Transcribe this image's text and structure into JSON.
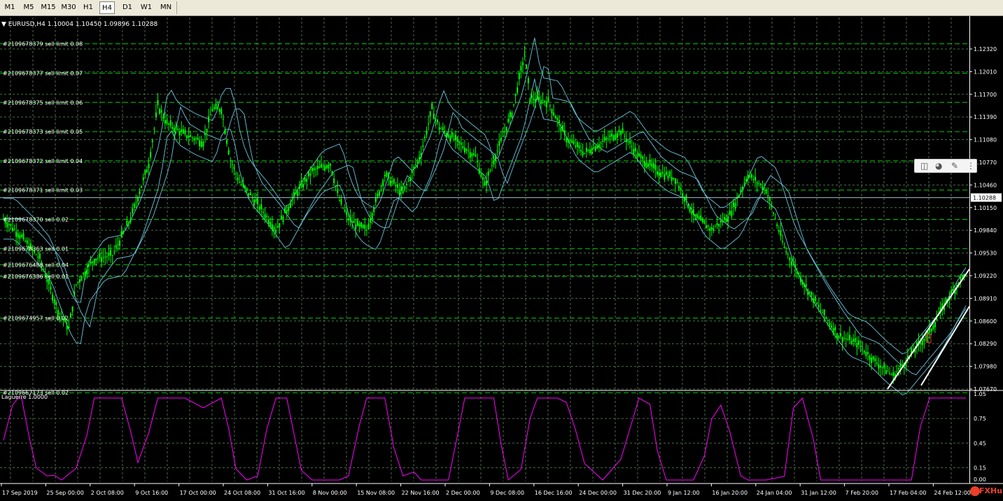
{
  "timeframes": [
    "M1",
    "M5",
    "M15",
    "M30",
    "H1",
    "H4",
    "D1",
    "W1",
    "MN"
  ],
  "active_timeframe": "H4",
  "header_line": "▼ EURUSD,H4  1.10004 1.10450 1.09896 1.10288",
  "indicator_label": "Laguerre 1.0000",
  "current_price": "1.10288",
  "watermark": "FXHub",
  "colors": {
    "candle": "#00ff00",
    "envelope": "#5fb3c9",
    "grid": "#4a6e4a",
    "laguerre": "#ff00ff",
    "level_line": "#00cc00",
    "axis_text": "#ffffff",
    "channel": "#ffffff"
  },
  "icons": [
    "split-view-icon",
    "sphere-icon",
    "pen-icon",
    "grip-icon"
  ],
  "orders": [
    {
      "label": "#2109678379 sell limit 0.08",
      "price": 1.1239
    },
    {
      "label": "#2109678377 sell limit 0.07",
      "price": 1.1199
    },
    {
      "label": "#2109678375 sell limit 0.06",
      "price": 1.1159
    },
    {
      "label": "#2109678373 sell limit 0.05",
      "price": 1.1119
    },
    {
      "label": "#2109678372 sell limit 0.04",
      "price": 1.1079
    },
    {
      "label": "#2109678371 sell limit 0.03",
      "price": 1.1039
    },
    {
      "label": "#2109678370 sell 0.02",
      "price": 1.0999
    },
    {
      "label": "#2109678363 sell 0.01",
      "price": 1.0959
    },
    {
      "label": "#2109676488 sell 0.04",
      "price": 1.0937
    },
    {
      "label": "#2109676386 sell 0.01",
      "price": 1.0921
    },
    {
      "label": "#2109674957 sell 0.02",
      "price": 1.0864
    },
    {
      "label": "#2109667173 sell 0.02",
      "price": 1.0762
    }
  ],
  "price_axis": [
    "1.12320",
    "1.12010",
    "1.11700",
    "1.11390",
    "1.11080",
    "1.10770",
    "1.10460",
    "1.10150",
    "1.09840",
    "1.09530",
    "1.09220",
    "1.08910",
    "1.08600",
    "1.08290",
    "1.07980",
    "1.07670"
  ],
  "indicator_axis": [
    "1.05",
    "0.75",
    "0.45",
    "0.15",
    "0.00"
  ],
  "time_axis": [
    "17 Sep 2019",
    "25 Sep 00:00",
    "2 Oct 08:00",
    "9 Oct 16:00",
    "17 Oct 00:00",
    "24 Oct 08:00",
    "31 Oct 16:00",
    "8 Nov 00:00",
    "15 Nov 08:00",
    "22 Nov 16:00",
    "2 Dec 00:00",
    "9 Dec 08:00",
    "16 Dec 16:00",
    "24 Dec 00:00",
    "31 Dec 20:00",
    "9 Jan 12:00",
    "16 Jan 20:00",
    "24 Jan 04:00",
    "31 Jan 12:00",
    "7 Feb 20:00",
    "17 Feb 04:00",
    "24 Feb 12:00"
  ],
  "chart_data": {
    "type": "candlestick",
    "symbol": "EURUSD",
    "timeframe": "H4",
    "ohlc_last": {
      "open": 1.10004,
      "high": 1.1045,
      "low": 1.09896,
      "close": 1.10288
    },
    "ylim": [
      1.0767,
      1.1275
    ],
    "x_labels": [
      "17 Sep 2019",
      "25 Sep 00:00",
      "2 Oct 08:00",
      "9 Oct 16:00",
      "17 Oct 00:00",
      "24 Oct 08:00",
      "31 Oct 16:00",
      "8 Nov 00:00",
      "15 Nov 08:00",
      "22 Nov 16:00",
      "2 Dec 00:00",
      "9 Dec 08:00",
      "16 Dec 16:00",
      "24 Dec 00:00",
      "31 Dec 20:00",
      "9 Jan 12:00",
      "16 Jan 20:00",
      "24 Jan 04:00",
      "31 Jan 12:00",
      "7 Feb 20:00",
      "17 Feb 04:00",
      "24 Feb 12:00"
    ],
    "close_path": [
      [
        0,
        1.1
      ],
      [
        1,
        1.0975
      ],
      [
        2,
        1.0945
      ],
      [
        3,
        1.0875
      ],
      [
        3.6,
        1.085
      ],
      [
        4,
        1.091
      ],
      [
        5,
        1.0945
      ],
      [
        6,
        1.095
      ],
      [
        7,
        1.1
      ],
      [
        8,
        1.1075
      ],
      [
        8.5,
        1.1155
      ],
      [
        9,
        1.113
      ],
      [
        10,
        1.1115
      ],
      [
        11,
        1.1105
      ],
      [
        11.5,
        1.115
      ],
      [
        12,
        1.115
      ],
      [
        12.5,
        1.108
      ],
      [
        13,
        1.105
      ],
      [
        14,
        1.102
      ],
      [
        15,
        1.0985
      ],
      [
        16,
        1.103
      ],
      [
        17,
        1.1065
      ],
      [
        18,
        1.1075
      ],
      [
        18.5,
        1.1025
      ],
      [
        19,
        1.1
      ],
      [
        19.5,
        1.099
      ],
      [
        20,
        1.0985
      ],
      [
        21,
        1.106
      ],
      [
        22,
        1.1035
      ],
      [
        23,
        1.109
      ],
      [
        23.6,
        1.115
      ],
      [
        24,
        1.1125
      ],
      [
        25,
        1.1105
      ],
      [
        26,
        1.1085
      ],
      [
        26.5,
        1.1045
      ],
      [
        27,
        1.108
      ],
      [
        28,
        1.1145
      ],
      [
        28.7,
        1.1225
      ],
      [
        29,
        1.1165
      ],
      [
        30,
        1.116
      ],
      [
        31,
        1.111
      ],
      [
        32,
        1.109
      ],
      [
        33,
        1.1105
      ],
      [
        34,
        1.112
      ],
      [
        35,
        1.1085
      ],
      [
        36,
        1.1065
      ],
      [
        37,
        1.1055
      ],
      [
        38,
        1.1005
      ],
      [
        39,
        1.0985
      ],
      [
        40,
        1.1005
      ],
      [
        41,
        1.106
      ],
      [
        42,
        1.104
      ],
      [
        43,
        1.096
      ],
      [
        44,
        1.0915
      ],
      [
        45,
        1.0875
      ],
      [
        46,
        1.084
      ],
      [
        47,
        1.083
      ],
      [
        48,
        1.0805
      ],
      [
        49,
        1.0785
      ],
      [
        50,
        1.0815
      ],
      [
        51,
        1.0845
      ],
      [
        52,
        1.089
      ],
      [
        53,
        1.0928
      ]
    ],
    "envelope_offset": 0.0028,
    "open_orders_prices": [
      1.1239,
      1.1199,
      1.1159,
      1.1119,
      1.1079,
      1.1039,
      1.0999,
      1.0959,
      1.0937,
      1.0921,
      1.0864,
      1.0762
    ],
    "current_price": 1.10288,
    "indicator": {
      "name": "Laguerre",
      "ylim": [
        0,
        1.05
      ],
      "levels": [
        0.75,
        0.45,
        0.15
      ],
      "path": [
        [
          0,
          0.45
        ],
        [
          0.5,
          0.9
        ],
        [
          0.8,
          1.0
        ],
        [
          1,
          1.0
        ],
        [
          1.4,
          0.5
        ],
        [
          1.8,
          0.1
        ],
        [
          2.4,
          0.05
        ],
        [
          2.8,
          0.1
        ],
        [
          3.2,
          0.0
        ],
        [
          4,
          0.15
        ],
        [
          4.6,
          0.5
        ],
        [
          5,
          1.0
        ],
        [
          6.5,
          1.0
        ],
        [
          7,
          0.65
        ],
        [
          7.4,
          0.2
        ],
        [
          8,
          0.6
        ],
        [
          8.5,
          1.0
        ],
        [
          9,
          1.0
        ],
        [
          10,
          1.0
        ],
        [
          11,
          0.85
        ],
        [
          12,
          1.0
        ],
        [
          12.4,
          0.6
        ],
        [
          12.8,
          0.15
        ],
        [
          13.4,
          0.0
        ],
        [
          14,
          0.05
        ],
        [
          14.5,
          0.6
        ],
        [
          15,
          1.0
        ],
        [
          15.6,
          1.0
        ],
        [
          16,
          0.6
        ],
        [
          16.4,
          0.1
        ],
        [
          17,
          0.0
        ],
        [
          18.5,
          0.0
        ],
        [
          19,
          0.05
        ],
        [
          19.6,
          0.7
        ],
        [
          20,
          1.0
        ],
        [
          21,
          1.0
        ],
        [
          21.5,
          0.4
        ],
        [
          22,
          0.05
        ],
        [
          22.6,
          0.1
        ],
        [
          23,
          0.0
        ],
        [
          24.5,
          0.0
        ],
        [
          25,
          0.5
        ],
        [
          25.4,
          1.0
        ],
        [
          26,
          1.0
        ],
        [
          27,
          1.0
        ],
        [
          27.4,
          0.4
        ],
        [
          27.8,
          0.0
        ],
        [
          28.5,
          0.15
        ],
        [
          29,
          0.7
        ],
        [
          29.4,
          1.0
        ],
        [
          30.5,
          1.0
        ],
        [
          31,
          0.9
        ],
        [
          31.5,
          0.6
        ],
        [
          32,
          0.15
        ],
        [
          33,
          0.0
        ],
        [
          34,
          0.2
        ],
        [
          35,
          1.0
        ],
        [
          35.6,
          0.9
        ],
        [
          36,
          0.4
        ],
        [
          36.5,
          0.0
        ],
        [
          38,
          0.0
        ],
        [
          38.6,
          0.3
        ],
        [
          39,
          0.8
        ],
        [
          39.5,
          0.95
        ],
        [
          40,
          0.55
        ],
        [
          40.6,
          0.05
        ],
        [
          41,
          0.0
        ],
        [
          42,
          0.0
        ],
        [
          43,
          0.1
        ],
        [
          43.5,
          0.9
        ],
        [
          44,
          1.0
        ],
        [
          44.6,
          0.5
        ],
        [
          45,
          0.0
        ],
        [
          46,
          0.0
        ],
        [
          47,
          0.0
        ],
        [
          48,
          0.0
        ],
        [
          49,
          0.0
        ],
        [
          50,
          0.0
        ],
        [
          50.5,
          0.7
        ],
        [
          51,
          1.0
        ],
        [
          53,
          1.0
        ]
      ]
    }
  }
}
